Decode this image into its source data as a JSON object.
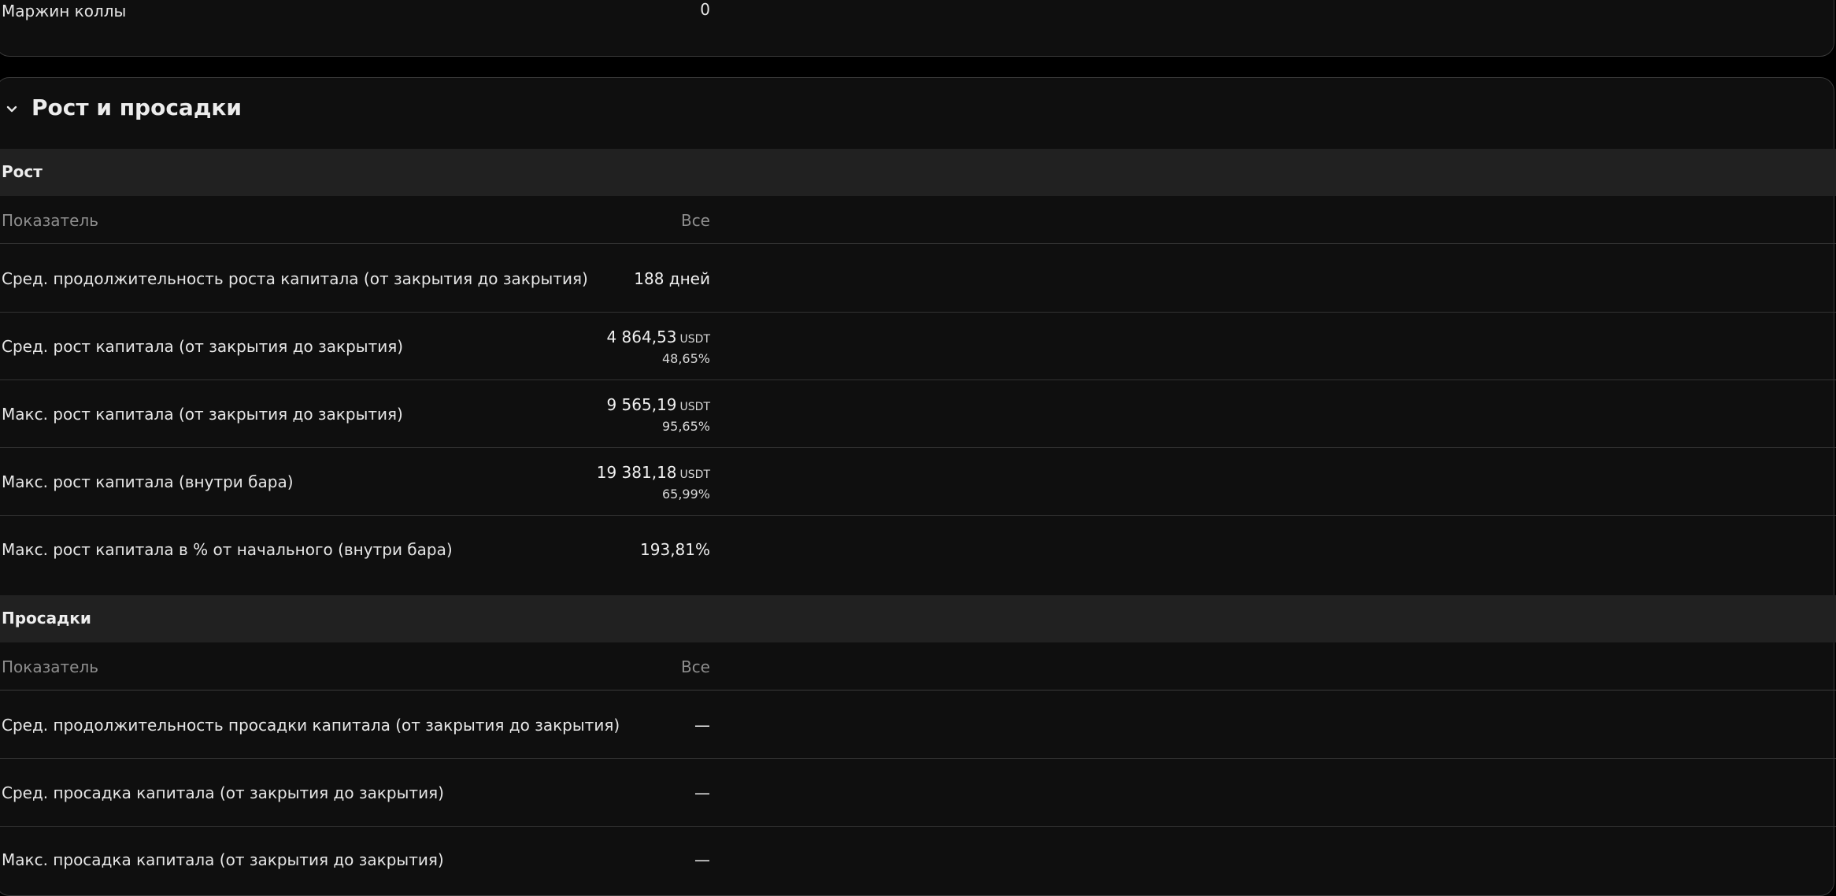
{
  "top": {
    "label": "Маржин коллы",
    "value": "0"
  },
  "section": {
    "title": "Рост и просадки",
    "chevron_icon": "chevron-down-icon"
  },
  "growth": {
    "title": "Рост",
    "col_label": "Показатель",
    "col_value": "Все",
    "rows": [
      {
        "label": "Сред. продолжительность роста капитала (от закрытия до закрытия)",
        "value": "188 дней",
        "unit": "",
        "sub": ""
      },
      {
        "label": "Сред. рост капитала (от закрытия до закрытия)",
        "value": "4 864,53",
        "unit": "USDT",
        "sub": "48,65%"
      },
      {
        "label": "Макс. рост капитала (от закрытия до закрытия)",
        "value": "9 565,19",
        "unit": "USDT",
        "sub": "95,65%"
      },
      {
        "label": "Макс. рост капитала (внутри бара)",
        "value": "19 381,18",
        "unit": "USDT",
        "sub": "65,99%"
      },
      {
        "label": "Макс. рост капитала в % от начального (внутри бара)",
        "value": "193,81%",
        "unit": "",
        "sub": ""
      }
    ]
  },
  "drawdowns": {
    "title": "Просадки",
    "col_label": "Показатель",
    "col_value": "Все",
    "rows": [
      {
        "label": "Сред. продолжительность просадки капитала (от закрытия до закрытия)",
        "value": "—"
      },
      {
        "label": "Сред. просадка капитала (от закрытия до закрытия)",
        "value": "—"
      },
      {
        "label": "Макс. просадка капитала (от закрытия до закрытия)",
        "value": "—"
      }
    ]
  }
}
